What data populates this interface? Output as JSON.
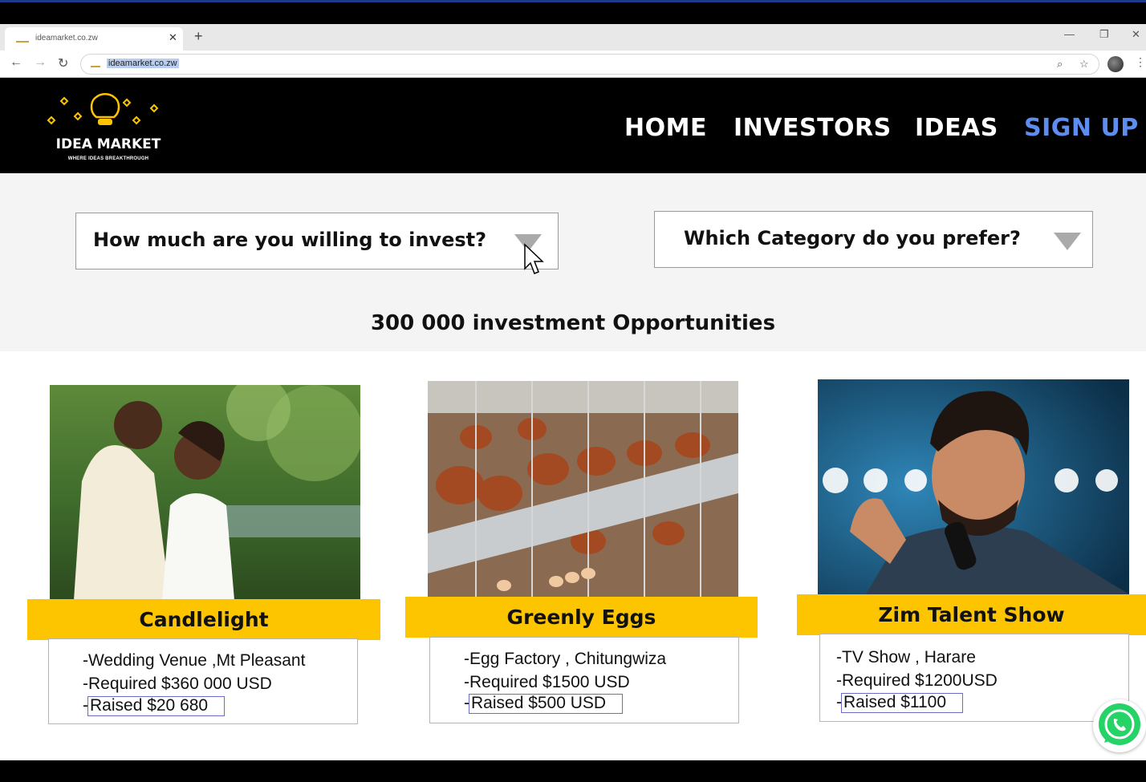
{
  "browser": {
    "tab_title": "ideamarket.co.zw",
    "url": "ideamarket.co.zw"
  },
  "logo": {
    "title": "IDEA MARKET",
    "tagline": "WHERE IDEAS BREAKTHROUGH",
    "accent_color": "#fcc500"
  },
  "nav": {
    "home": "HOME",
    "investors": "INVESTORS",
    "ideas": "IDEAS",
    "signup": "SIGN UP",
    "signup_color": "#5e8df0"
  },
  "filters": {
    "invest_amount": "How much are you willing to invest?",
    "category": "Which Category do you prefer?"
  },
  "opportunities_heading": "300 000 investment  Opportunities",
  "cards": [
    {
      "title": "Candlelight",
      "line1": "-Wedding Venue ,Mt Pleasant",
      "line2": "-Required $360 000 USD",
      "raised": "Raised  $20 680",
      "image": "wedding-couple-photo"
    },
    {
      "title": "Greenly Eggs",
      "line1": "-Egg Factory , Chitungwiza",
      "line2": "-Required $1500 USD",
      "raised": "Raised  $500 USD",
      "image": "chicken-coop-photo"
    },
    {
      "title": "Zim Talent Show",
      "line1": "-TV Show , Harare",
      "line2": "-Required $1200USD",
      "raised": "Raised  $1100",
      "image": "singer-photo"
    }
  ],
  "colors": {
    "band": "#fcc500",
    "header_bg": "#000000",
    "whatsapp": "#25d366"
  }
}
